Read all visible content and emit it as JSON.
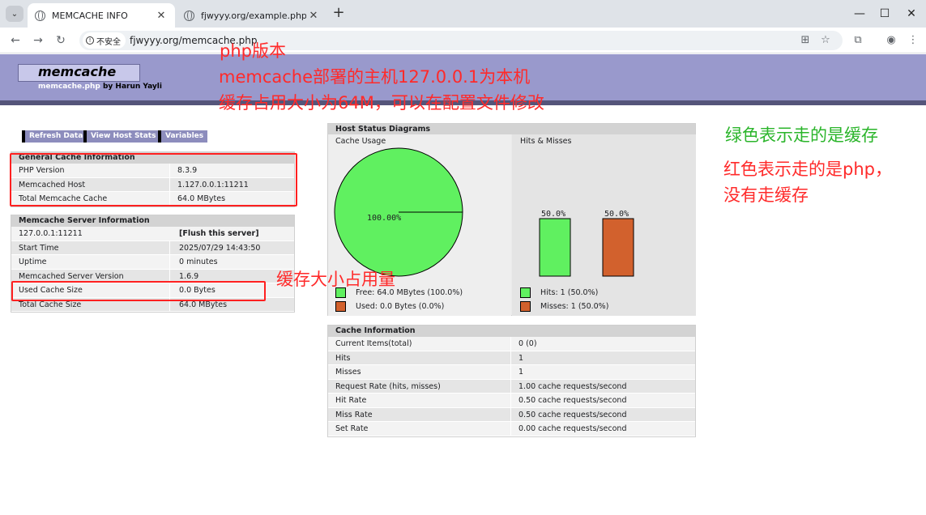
{
  "browser": {
    "tabs": [
      {
        "title": "MEMCACHE INFO",
        "active": true
      },
      {
        "title": "fjwyyy.org/example.php",
        "active": false
      }
    ],
    "security_label": "不安全",
    "url": "fjwyyy.org/memcache.php"
  },
  "header": {
    "logo": "memcache",
    "subtitle_file": "memcache.php",
    "subtitle_by": "by",
    "subtitle_author": "Harun Yayli"
  },
  "menu": [
    "Refresh Data",
    "View Host Stats",
    "Variables"
  ],
  "general": {
    "title": "General Cache Information",
    "rows": [
      {
        "key": "PHP Version",
        "value": "8.3.9"
      },
      {
        "key": "Memcached Host",
        "value": "1.127.0.0.1:11211"
      },
      {
        "key": "Total Memcache Cache",
        "value": "64.0 MBytes"
      }
    ]
  },
  "server": {
    "title": "Memcache Server Information",
    "rows": [
      {
        "key": "127.0.0.1:11211",
        "value": "[Flush this server]"
      },
      {
        "key": "Start Time",
        "value": "2025/07/29 14:43:50"
      },
      {
        "key": "Uptime",
        "value": "0 minutes"
      },
      {
        "key": "Memcached Server Version",
        "value": "1.6.9"
      },
      {
        "key": "Used Cache Size",
        "value": "0.0 Bytes"
      },
      {
        "key": "Total Cache Size",
        "value": "64.0 MBytes"
      }
    ]
  },
  "diagrams": {
    "title": "Host Status Diagrams",
    "usage_title": "Cache Usage",
    "hits_title": "Hits & Misses",
    "pie_label": "100.00%",
    "hit_pct_label": "50.0%",
    "miss_pct_label": "50.0%",
    "legend": {
      "free": "Free: 64.0 MBytes (100.0%)",
      "used": "Used: 0.0 Bytes (0.0%)",
      "hits": "Hits: 1 (50.0%)",
      "misses": "Misses: 1 (50.0%)"
    },
    "colors": {
      "green": "#60f060",
      "orange": "#d2612d"
    }
  },
  "chart_data": [
    {
      "type": "pie",
      "title": "Cache Usage",
      "categories": [
        "Free",
        "Used"
      ],
      "values": [
        100.0,
        0.0
      ]
    },
    {
      "type": "bar",
      "title": "Hits & Misses",
      "categories": [
        "Hits",
        "Misses"
      ],
      "values": [
        50.0,
        50.0
      ]
    }
  ],
  "cache_info": {
    "title": "Cache Information",
    "rows": [
      {
        "key": "Current Items(total)",
        "value": "0 (0)"
      },
      {
        "key": "Hits",
        "value": "1"
      },
      {
        "key": "Misses",
        "value": "1"
      },
      {
        "key": "Request Rate (hits, misses)",
        "value": "1.00 cache requests/second"
      },
      {
        "key": "Hit Rate",
        "value": "0.50 cache requests/second"
      },
      {
        "key": "Miss Rate",
        "value": "0.50 cache requests/second"
      },
      {
        "key": "Set Rate",
        "value": "0.00 cache requests/second"
      }
    ]
  },
  "annotations": {
    "php_version": "php版本",
    "host": "memcache部署的主机127.0.0.1为本机",
    "size": "缓存占用大小为64M，可以在配置文件修改",
    "used_size": "缓存大小占用量",
    "green_note": "绿色表示走的是缓存",
    "red_note_1": "红色表示走的是php，",
    "red_note_2": "没有走缓存"
  }
}
